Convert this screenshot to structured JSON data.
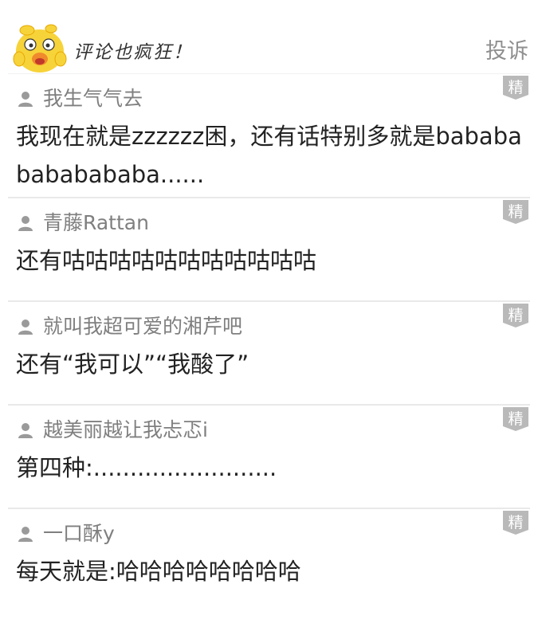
{
  "header": {
    "title": "评论也疯狂！",
    "report_label": "投诉"
  },
  "badge_text": "精",
  "colors": {
    "badge_bg": "#b9b9b9",
    "divider": "#e9e9e9",
    "username": "#7f7f7f",
    "mascot_yellow": "#f7d33a"
  },
  "comments": [
    {
      "username": "我生气气去",
      "content": "我现在就是zzzzzz困，还有话特别多就是babababababababa......"
    },
    {
      "username": "青藤Rattan",
      "content": "还有咕咕咕咕咕咕咕咕咕咕咕"
    },
    {
      "username": "就叫我超可爱的湘芹吧",
      "content": "还有“我可以”“我酸了”"
    },
    {
      "username": "越美丽越让我忐忑i",
      "content": "第四种:........................."
    },
    {
      "username": "一口酥y",
      "content": "每天就是:哈哈哈哈哈哈哈哈"
    }
  ]
}
